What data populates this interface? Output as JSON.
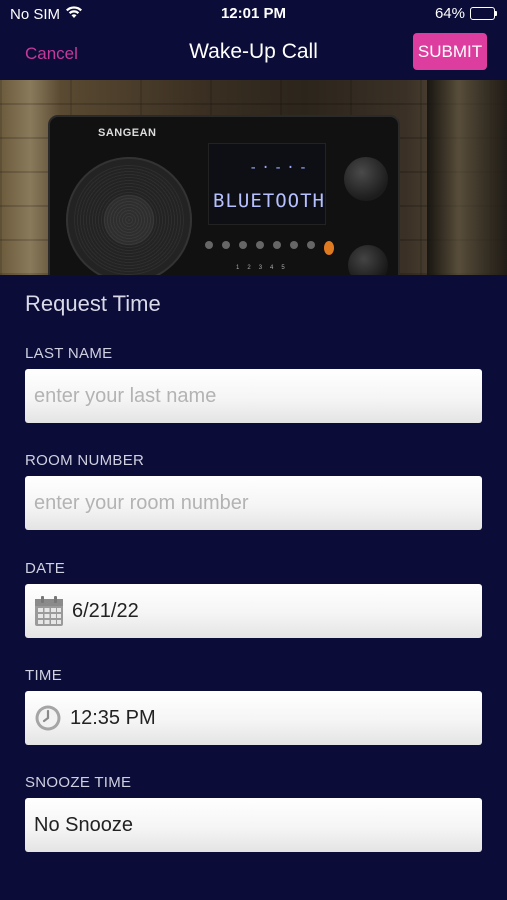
{
  "status_bar": {
    "carrier": "No SIM",
    "time": "12:01 PM",
    "battery_percent": "64%",
    "battery_level": 0.64
  },
  "nav": {
    "cancel_label": "Cancel",
    "title": "Wake-Up Call",
    "submit_label": "SUBMIT"
  },
  "hero": {
    "brand": "SANGEAN",
    "display_text": "BLUETOOTH"
  },
  "form": {
    "section_title": "Request Time",
    "last_name": {
      "label": "LAST NAME",
      "placeholder": "enter your last name",
      "value": ""
    },
    "room_number": {
      "label": "ROOM NUMBER",
      "placeholder": "enter your room number",
      "value": ""
    },
    "date": {
      "label": "DATE",
      "value": "6/21/22",
      "icon": "calendar-icon"
    },
    "time": {
      "label": "TIME",
      "value": "12:35 PM",
      "icon": "clock-icon"
    },
    "snooze": {
      "label": "SNOOZE TIME",
      "value": "No Snooze"
    }
  },
  "colors": {
    "background": "#0b0c38",
    "accent": "#dc3d9f",
    "cancel": "#c43a9b"
  }
}
